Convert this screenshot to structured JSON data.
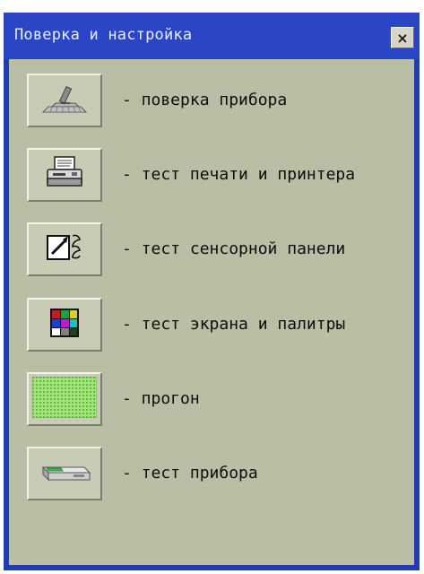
{
  "window": {
    "title": "Поверка и настройка",
    "close_glyph": "×"
  },
  "items": [
    {
      "label": "- поверка прибора",
      "icon": "calibration-icon"
    },
    {
      "label": "- тест печати и принтера",
      "icon": "printer-icon"
    },
    {
      "label": "- тест сенсорной панели",
      "icon": "touchpanel-icon"
    },
    {
      "label": "- тест экрана и палитры",
      "icon": "palette-icon"
    },
    {
      "label": "- прогон",
      "icon": "grid-icon"
    },
    {
      "label": "- тест прибора",
      "icon": "device-icon"
    }
  ],
  "colors": {
    "titlebar": "#2a46c6",
    "client": "#b9bea5",
    "button": "#c8ccb5"
  }
}
